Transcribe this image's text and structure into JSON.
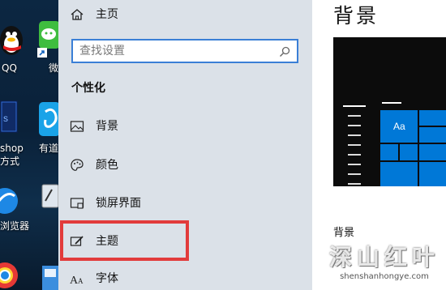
{
  "desktop": {
    "labels": [
      "QQ",
      "微",
      "shop",
      "方式",
      "有道",
      "浏览器"
    ]
  },
  "nav": {
    "home_label": "主页",
    "search_placeholder": "查找设置",
    "section_title": "个性化",
    "items": [
      {
        "label": "背景",
        "icon": "picture-icon"
      },
      {
        "label": "颜色",
        "icon": "palette-icon"
      },
      {
        "label": "锁屏界面",
        "icon": "lock-screen-icon"
      },
      {
        "label": "主题",
        "icon": "theme-brush-icon"
      },
      {
        "label": "字体",
        "icon": "font-icon"
      }
    ]
  },
  "content": {
    "title": "背景",
    "preview_tile_label": "Aa",
    "subhead": "背景"
  },
  "watermark": {
    "text": "深山红叶",
    "url": "shenshanhongye.com"
  },
  "colors": {
    "accent": "#0078d7",
    "highlight": "#e23b3b",
    "nav_bg": "#dbe1e8"
  }
}
